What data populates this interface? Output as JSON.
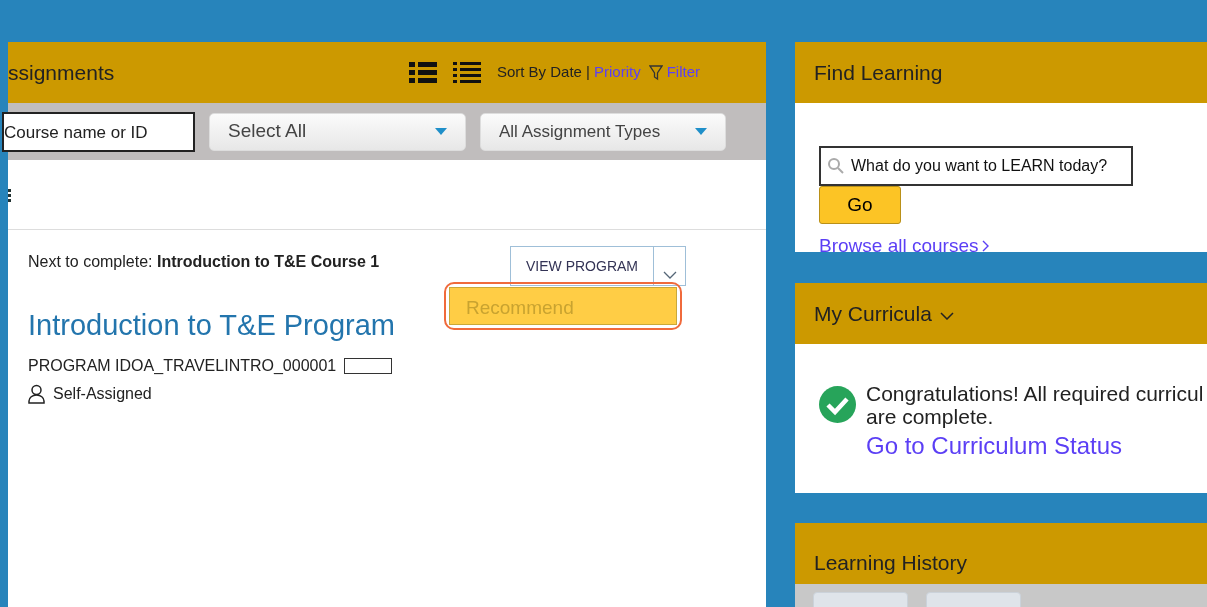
{
  "assignments": {
    "title": "ssignments",
    "sort_label": "Sort By Date |",
    "sort_links": [
      "Priority",
      "Filter"
    ],
    "search": {
      "value": "Course name or ID"
    },
    "dropdowns": [
      {
        "value": "Select All"
      },
      {
        "value": "All Assignment Types"
      }
    ],
    "item": {
      "next": "Next to complete: **Introduction to T&E Course 1**",
      "button": "VIEW PROGRAM",
      "menu": [
        {
          "label": "Recommend",
          "selected": true
        }
      ],
      "title": "Introduction to T&E Program",
      "code": "PROGRAM IDOA_TRAVELINTRO_000001",
      "assigned": "Self-Assigned"
    }
  },
  "find_learning": {
    "title": "Find Learning",
    "placeholder": "What do you want to LEARN today?",
    "button": "Go",
    "link": "Browse all courses"
  },
  "curricula": {
    "title": "My Curricula",
    "message": [
      "Congratulations! All required curricul",
      "are complete."
    ],
    "link": "Go to Curriculum Status"
  },
  "history": {
    "title": "Learning History"
  }
}
